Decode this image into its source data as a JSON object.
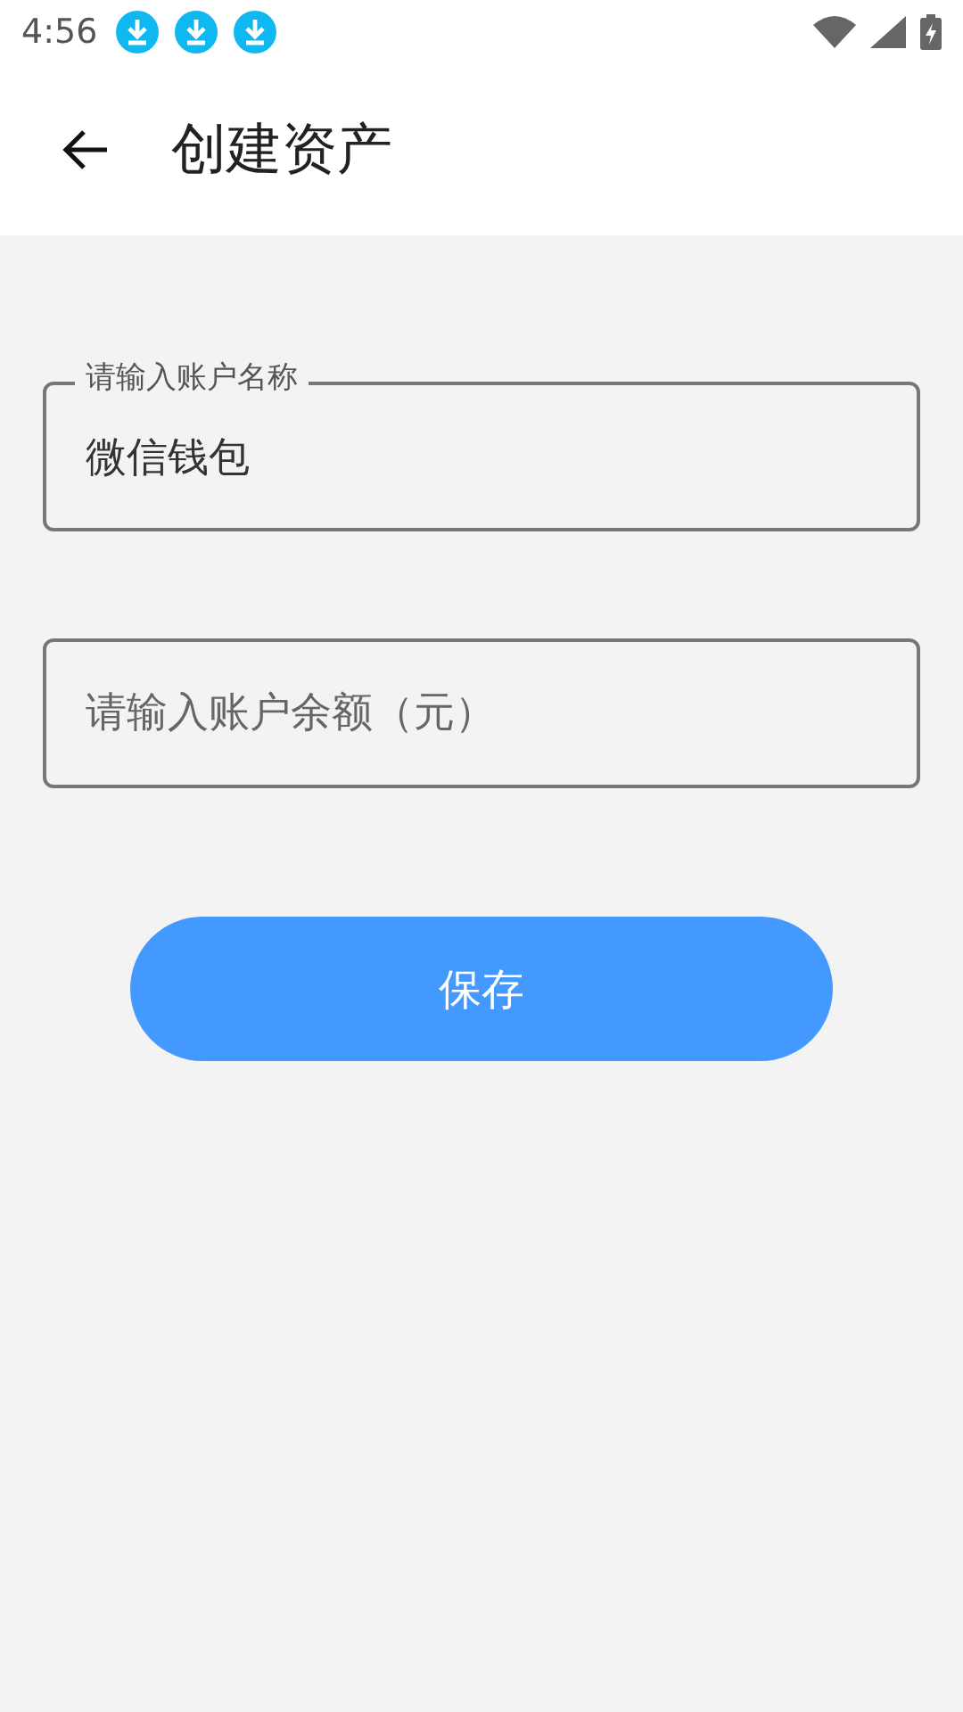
{
  "status_bar": {
    "time": "4:56",
    "notifications": [
      {
        "kind": "download"
      },
      {
        "kind": "download"
      },
      {
        "kind": "download"
      }
    ]
  },
  "app_bar": {
    "title": "创建资产"
  },
  "form": {
    "fields": [
      {
        "label": "请输入账户名称",
        "value": "微信钱包"
      },
      {
        "placeholder": "请输入账户余额（元）"
      }
    ],
    "save_button": "保存"
  }
}
